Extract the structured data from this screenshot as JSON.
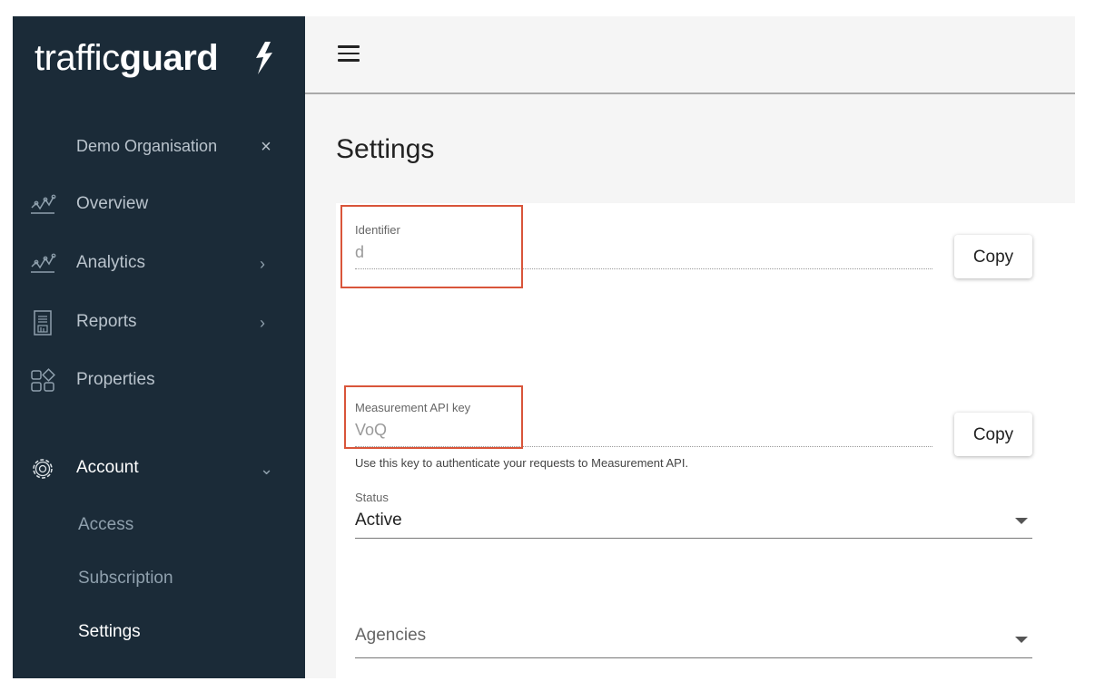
{
  "brand": {
    "name_light": "traffic",
    "name_bold": "guard"
  },
  "sidebar": {
    "organisation": "Demo Organisation",
    "nav": [
      {
        "label": "Overview",
        "icon": "line-chart-icon"
      },
      {
        "label": "Analytics",
        "icon": "line-chart-icon",
        "chevron": "›"
      },
      {
        "label": "Reports",
        "icon": "report-document-icon",
        "chevron": "›"
      },
      {
        "label": "Properties",
        "icon": "shapes-grid-icon"
      },
      {
        "label": "Account",
        "icon": "gear-icon",
        "chevron": "⌄"
      }
    ],
    "account_sub": [
      {
        "label": "Access"
      },
      {
        "label": "Subscription"
      },
      {
        "label": "Settings"
      }
    ],
    "close_glyph": "×"
  },
  "page": {
    "title": "Settings",
    "identifier": {
      "label": "Identifier",
      "value": "d",
      "copy_label": "Copy"
    },
    "api_key": {
      "label": "Measurement API key",
      "value": "VoQ",
      "copy_label": "Copy",
      "helper": "Use this key to authenticate your requests to Measurement API."
    },
    "status": {
      "label": "Status",
      "value": "Active"
    },
    "agencies": {
      "placeholder": "Agencies"
    }
  },
  "colors": {
    "sidebar_bg": "#1b2b38",
    "highlight": "#d9553a"
  }
}
